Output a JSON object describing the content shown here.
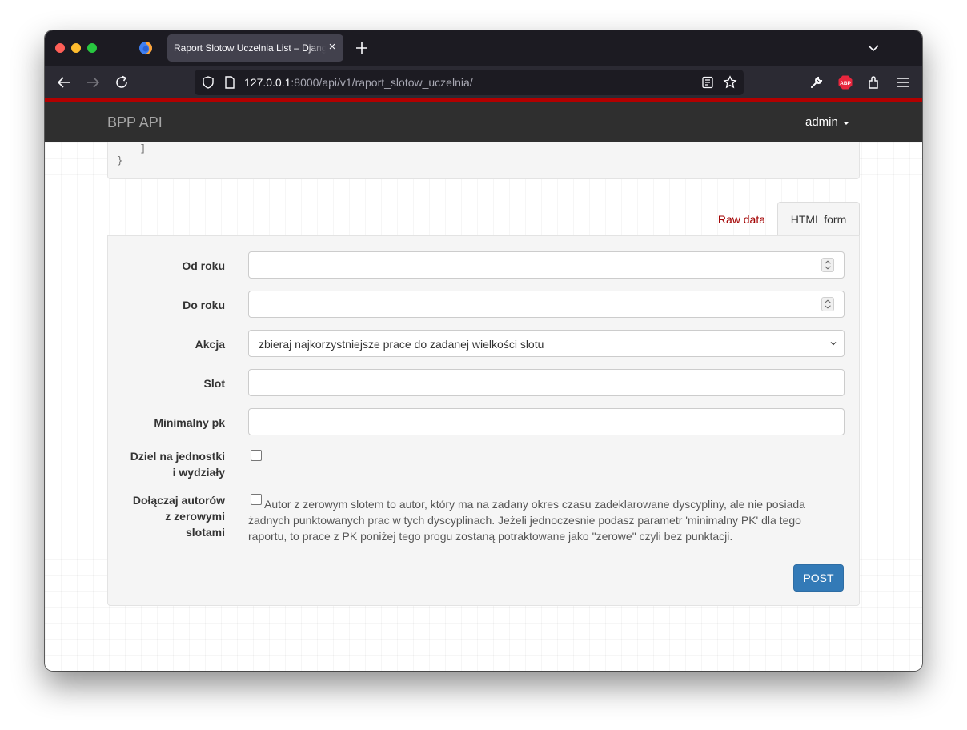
{
  "browser": {
    "tab_title": "Raport Slotow Uczelnia List – Django REST framework",
    "tab_close": "×",
    "url_host": "127.0.0.1",
    "url_rest": ":8000/api/v1/raport_slotow_uczelnia/",
    "accent_color": "#b30000"
  },
  "navbar": {
    "brand": "BPP API",
    "user": "admin"
  },
  "response": {
    "lines": [
      "        }",
      "    ]",
      "}"
    ]
  },
  "tabs": {
    "raw": "Raw data",
    "html": "HTML form"
  },
  "form": {
    "od_roku_label": "Od roku",
    "do_roku_label": "Do roku",
    "akcja_label": "Akcja",
    "akcja_value": "zbieraj najkorzystniejsze prace do zadanej wielkości slotu",
    "slot_label": "Slot",
    "minimalny_pk_label": "Minimalny pk",
    "dziel_label_1": "Dziel na jednostki",
    "dziel_label_2": "i wydziały",
    "dolaczaj_label_1": "Dołączaj autorów",
    "dolaczaj_label_2": "z zerowymi",
    "dolaczaj_label_3": "slotami",
    "dolaczaj_help": "Autor z zerowym slotem to autor, który ma na zadany okres czasu zadeklarowane dyscypliny, ale nie posiada żadnych punktowanych prac w tych dyscyplinach. Jeżeli jednoczesnie podasz parametr 'minimalny PK' dla tego raportu, to prace z PK poniżej tego progu zostaną potraktowane jako \"zerowe\" czyli bez punktacji.",
    "submit": "POST",
    "submit_color": "#337ab7"
  }
}
